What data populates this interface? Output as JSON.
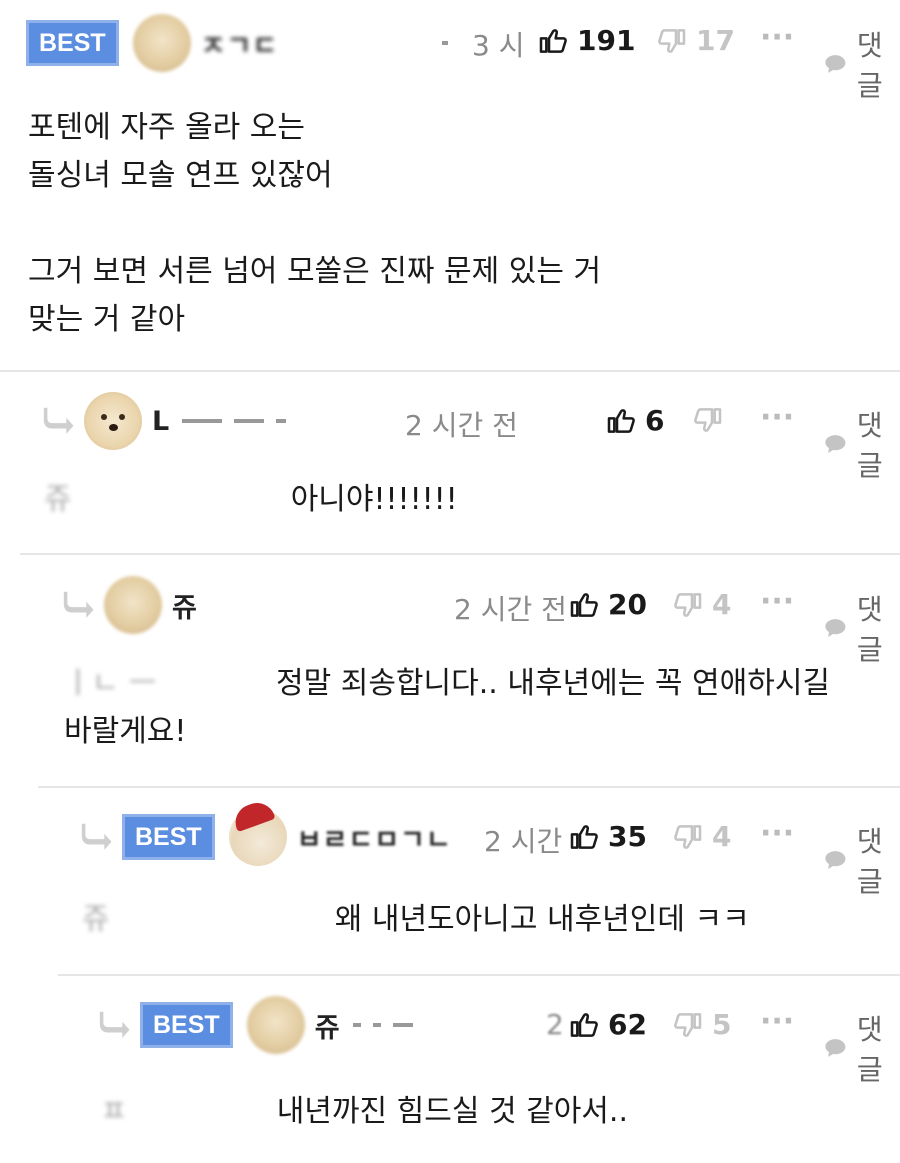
{
  "best_label": "BEST",
  "comments": [
    {
      "user": "ㅈㄱㄷ",
      "time": "3 시",
      "likes": "191",
      "dislikes": "17",
      "reply_label": "댓글",
      "lines": [
        "포텐에 자주 올라 오는",
        "돌싱녀 모솔 연프 있잖어",
        "",
        "그거 보면 서른 넘어 모쏠은 진짜 문제 있는 거",
        "맞는 거 같아"
      ]
    },
    {
      "user": "L",
      "time": "2 시간 전",
      "likes": "6",
      "dislikes": "",
      "reply_label": "댓글",
      "mention": "쥬",
      "text": "아니야!!!!!!!"
    },
    {
      "user": "쥬",
      "time": "2 시간 전",
      "likes": "20",
      "dislikes": "4",
      "reply_label": "댓글",
      "text": "정말 죄송합니다.. 내후년에는 꼭 연애하시길",
      "text2": "바랄게요!"
    },
    {
      "user": "ㅂㄹㄷㅁㄱㄴ",
      "time": "2 시간",
      "likes": "35",
      "dislikes": "4",
      "reply_label": "댓글",
      "mention": "쥬",
      "text": "왜 내년도아니고 내후년인데 ㅋㅋ"
    },
    {
      "user": "쥬",
      "time": "2",
      "likes": "62",
      "dislikes": "5",
      "reply_label": "댓글",
      "mention": "ㅍ",
      "text": "내년까진 힘드실 것 같아서.."
    }
  ],
  "colors": {
    "best_bg": "#5b8ee0",
    "icon_gray": "#c4c4c4",
    "divider": "#e6e6e6"
  }
}
